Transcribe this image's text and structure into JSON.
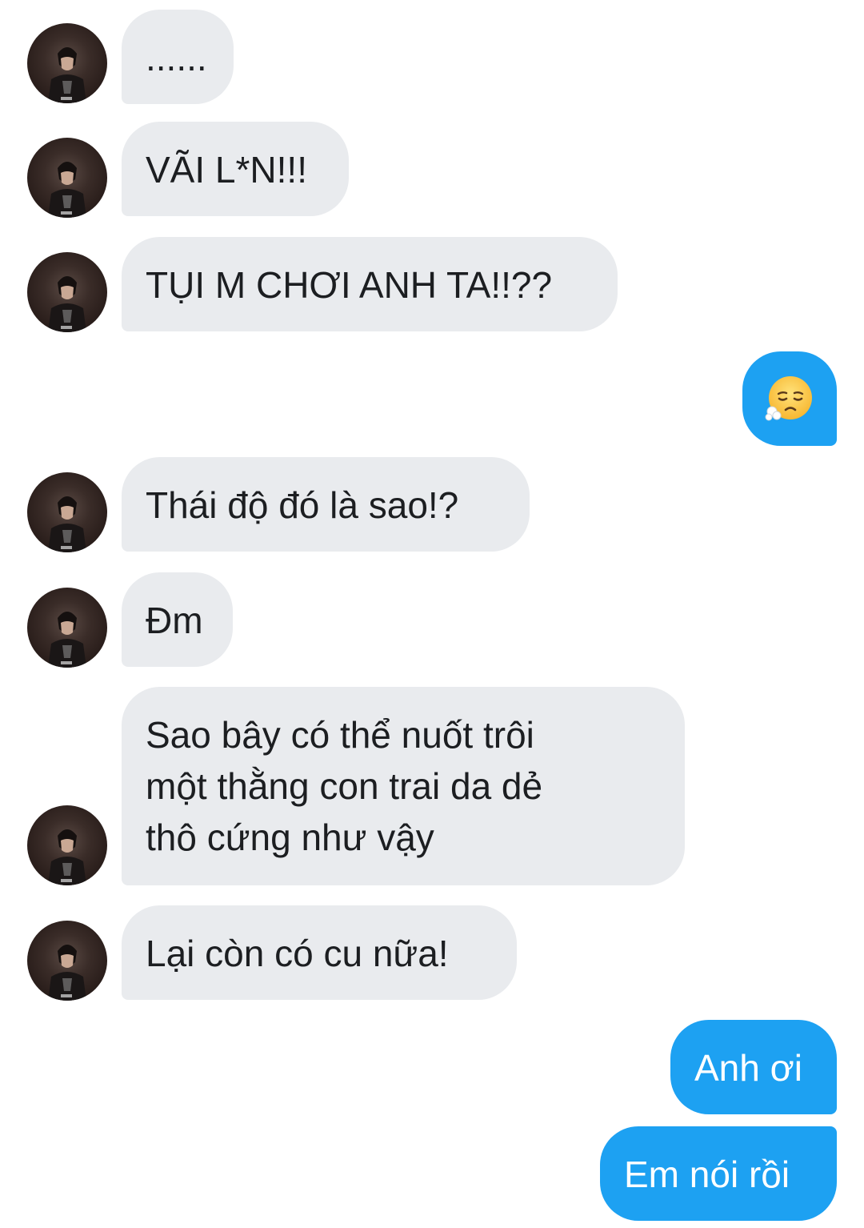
{
  "conversation": {
    "messages": [
      {
        "sender": "them",
        "text": "......"
      },
      {
        "sender": "them",
        "text": "VÃI L*N!!!"
      },
      {
        "sender": "them",
        "text": "TỤI M CHƠI ANH TA!!??"
      },
      {
        "sender": "me",
        "emoji": "face-exhaling"
      },
      {
        "sender": "them",
        "text": "Thái độ đó là sao!?"
      },
      {
        "sender": "them",
        "text": "Đm"
      },
      {
        "sender": "them",
        "lines": [
          "Sao bây có thể nuốt trôi",
          "một thằng con trai da dẻ",
          "thô cứng như vậy"
        ]
      },
      {
        "sender": "them",
        "text": "Lại còn có cu nữa!"
      },
      {
        "sender": "me",
        "text": "Anh ơi"
      },
      {
        "sender": "me",
        "text": "Em nói rồi"
      }
    ]
  },
  "colors": {
    "incoming_bubble": "#e9ebee",
    "outgoing_bubble": "#1da1f2",
    "incoming_text": "#1c1e21",
    "outgoing_text": "#ffffff"
  }
}
